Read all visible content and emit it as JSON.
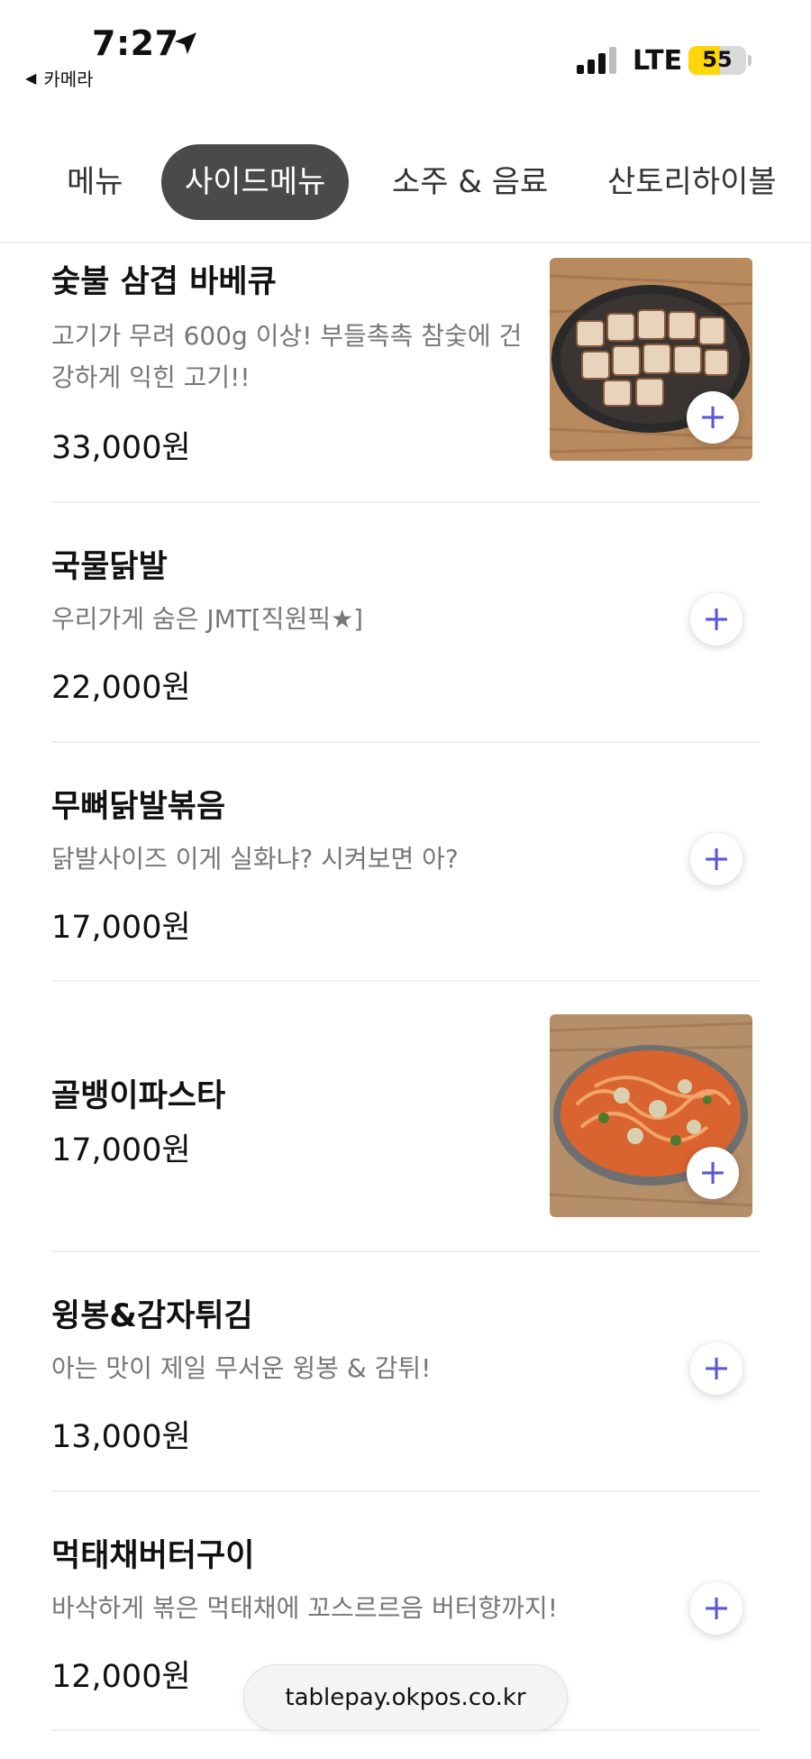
{
  "status_bar": {
    "time": "7:27",
    "back_app": "카메라",
    "network": "LTE",
    "battery": "55",
    "battery_level": 0.55
  },
  "tabs": [
    {
      "label": "메뉴"
    },
    {
      "label": "사이드메뉴",
      "active": true
    },
    {
      "label": "소주 & 음료"
    },
    {
      "label": "산토리하이볼"
    }
  ],
  "menu": [
    {
      "name": "숯불 삼겹 바베큐",
      "desc": "고기가 무려 600g 이상! 부들촉촉 참숯에 건강하게 익힌 고기!!",
      "price": "33,000원",
      "photo": "grilled-pork-belly-photo"
    },
    {
      "name": "국물닭발",
      "desc": "우리가게 숨은 JMT[직원픽★]",
      "price": "22,000원"
    },
    {
      "name": "무뼈닭발볶음",
      "desc": "닭발사이즈 이게 실화냐? 시켜보면 아?",
      "price": "17,000원"
    },
    {
      "name": "골뱅이파스타",
      "desc": "",
      "price": "17,000원",
      "photo": "whelk-pasta-photo"
    },
    {
      "name": "윙봉&감자튀김",
      "desc": "아는 맛이 제일 무서운 윙봉 & 감튀!",
      "price": "13,000원"
    },
    {
      "name": "먹태채버터구이",
      "desc": "바삭하게 볶은 먹태채에 꼬스르르음 버터향까지!",
      "price": "12,000원"
    }
  ],
  "add_button_label": "+",
  "url_bar": {
    "url": "tablepay.okpos.co.kr"
  },
  "colors": {
    "accent": "#5a58d6",
    "tab_active_bg": "#4a4a4a",
    "desc_text": "#777777",
    "battery": "#ffd60a"
  }
}
